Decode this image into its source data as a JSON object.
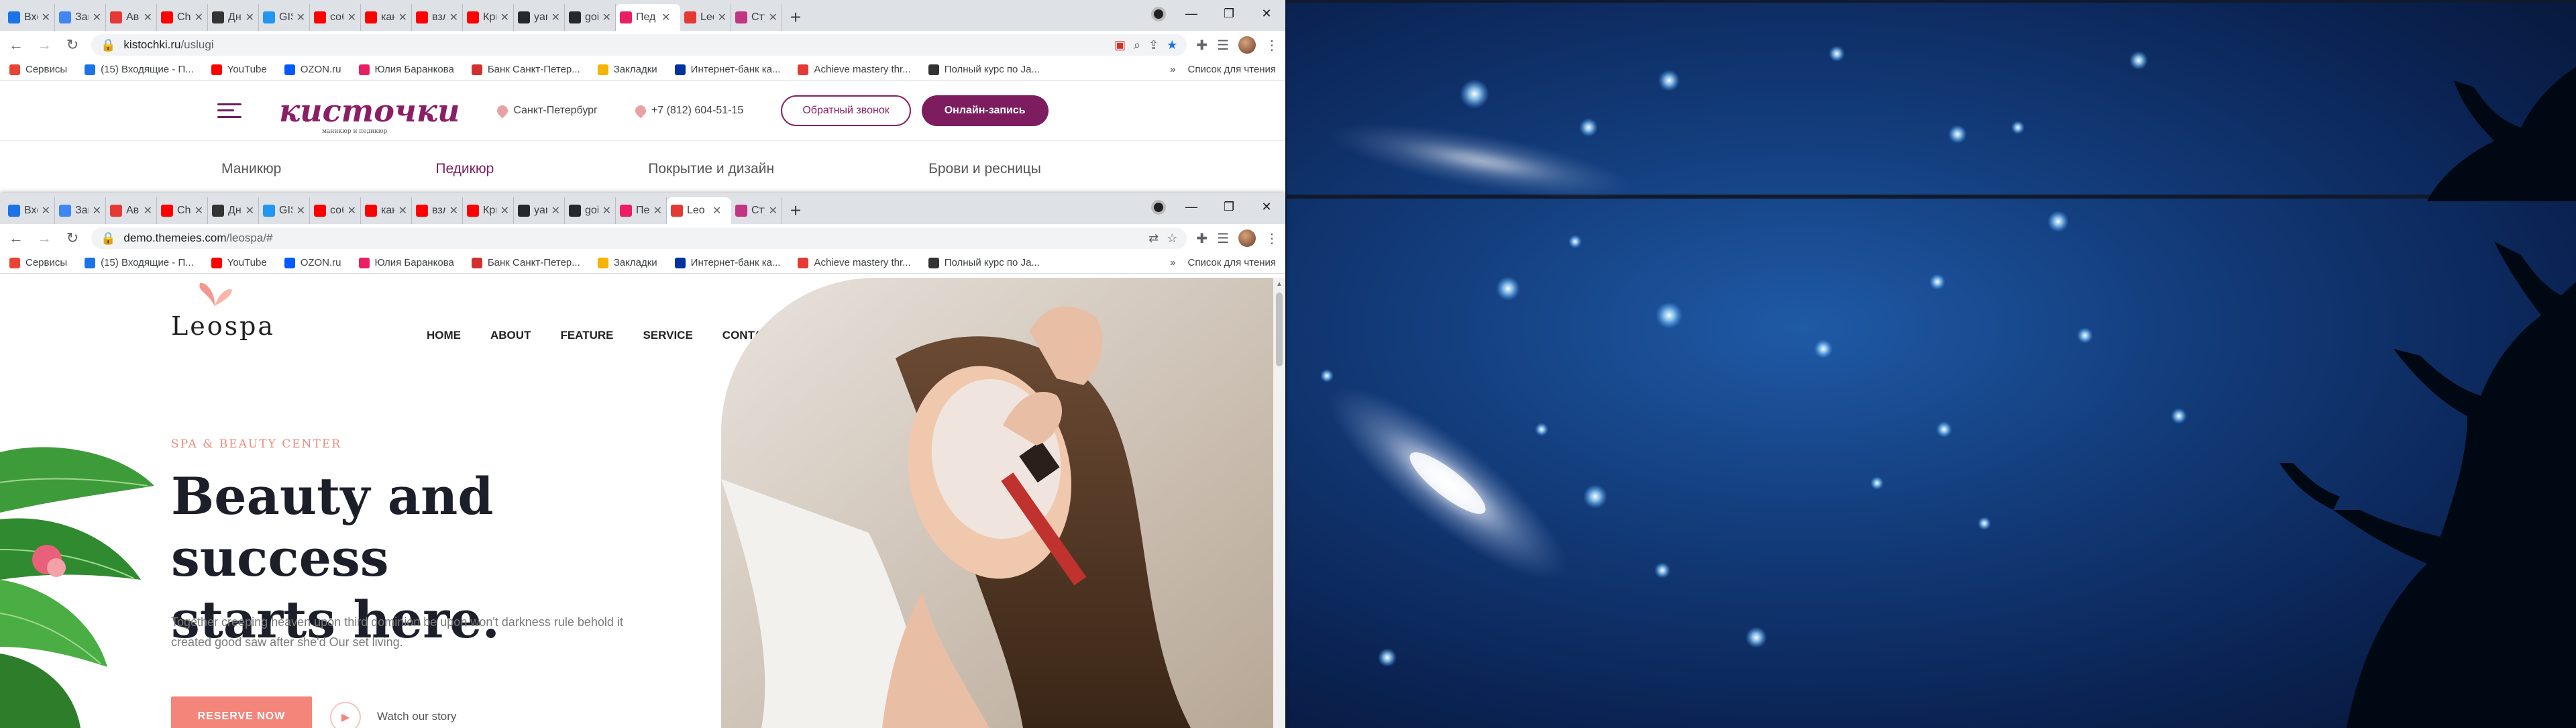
{
  "tabs_top": [
    {
      "title": "Вход",
      "fav": "#1a73e8"
    },
    {
      "title": "Закл",
      "fav": "#4285f4"
    },
    {
      "title": "Ави",
      "fav": "#e53935"
    },
    {
      "title": "Chi",
      "fav": "#ff0000"
    },
    {
      "title": "Дне",
      "fav": "#333333"
    },
    {
      "title": "GIS",
      "fav": "#2196f3"
    },
    {
      "title": "соб",
      "fav": "#ff0000"
    },
    {
      "title": "как",
      "fav": "#ff0000"
    },
    {
      "title": "взл",
      "fav": "#ff0000"
    },
    {
      "title": "Кри",
      "fav": "#ff0000"
    },
    {
      "title": "yan",
      "fav": "#24292e"
    },
    {
      "title": "goi",
      "fav": "#24292e"
    },
    {
      "title": "Пед",
      "fav": "#e91e63",
      "active": true
    },
    {
      "title": "Leo",
      "fav": "#e53935"
    },
    {
      "title": "Сту",
      "fav": "#c13584"
    }
  ],
  "tabs_bottom": [
    {
      "title": "Вхо",
      "fav": "#1a73e8"
    },
    {
      "title": "Закл",
      "fav": "#4285f4"
    },
    {
      "title": "Ави",
      "fav": "#e53935"
    },
    {
      "title": "Chi",
      "fav": "#ff0000"
    },
    {
      "title": "Дне",
      "fav": "#333333"
    },
    {
      "title": "GIS",
      "fav": "#2196f3"
    },
    {
      "title": "соб",
      "fav": "#ff0000"
    },
    {
      "title": "как",
      "fav": "#ff0000"
    },
    {
      "title": "взл",
      "fav": "#ff0000"
    },
    {
      "title": "Кри",
      "fav": "#ff0000"
    },
    {
      "title": "yan",
      "fav": "#24292e"
    },
    {
      "title": "goi",
      "fav": "#24292e"
    },
    {
      "title": "Пе",
      "fav": "#e91e63"
    },
    {
      "title": "Leo",
      "fav": "#e53935",
      "active": true
    },
    {
      "title": "Сту",
      "fav": "#c13584"
    }
  ],
  "window_controls": {
    "minimize": "—",
    "restore": "❐",
    "close": "✕"
  },
  "top_window": {
    "url_host": "kistochki.ru",
    "url_path": "/uslugi"
  },
  "bottom_window": {
    "url_host": "demo.themeies.com",
    "url_path": "/leospa/#"
  },
  "bookmarks": {
    "items": [
      {
        "label": "Сервисы",
        "color": "#ea4335"
      },
      {
        "label": "(15) Входящие - П...",
        "color": "#1a73e8"
      },
      {
        "label": "YouTube",
        "color": "#ff0000"
      },
      {
        "label": "OZON.ru",
        "color": "#005bff"
      },
      {
        "label": "Юлия Баранкова",
        "color": "#e91e63"
      },
      {
        "label": "Банк Санкт-Петер...",
        "color": "#d32f2f"
      },
      {
        "label": "Закладки",
        "color": "#f4b400"
      },
      {
        "label": "Интернет-банк ка...",
        "color": "#0033a0"
      },
      {
        "label": "Achieve mastery thr...",
        "color": "#e53935"
      },
      {
        "label": "Полный курс по Ja...",
        "color": "#333333"
      }
    ],
    "more": "»",
    "reading_list": "Список для чтения"
  },
  "kistochki": {
    "logo": "кисточки",
    "logo_sub": "маникюр и педикюр",
    "city": "Санкт-Петербург",
    "phone": "+7 (812) 604-51-15",
    "callback": "Обратный звонок",
    "booking": "Онлайн-запись",
    "nav": [
      "Маникюр",
      "Педикюр",
      "Покрытие и дизайн",
      "Брови и ресницы"
    ],
    "active_nav_index": 1
  },
  "leospa": {
    "logo": "Leospa",
    "menu": [
      "HOME",
      "ABOUT",
      "FEATURE",
      "SERVICE",
      "CONTACT"
    ],
    "kicker": "SPA & BEAUTY CENTER",
    "title_line1": "Beauty and success",
    "title_line2": "starts here.",
    "description": "Together creeping heaven upon third dominion be upon won't darkness rule behold it created good saw after she'd Our set living.",
    "reserve": "RESERVE NOW",
    "watch": "Watch our story",
    "accent": "#f3857a"
  }
}
